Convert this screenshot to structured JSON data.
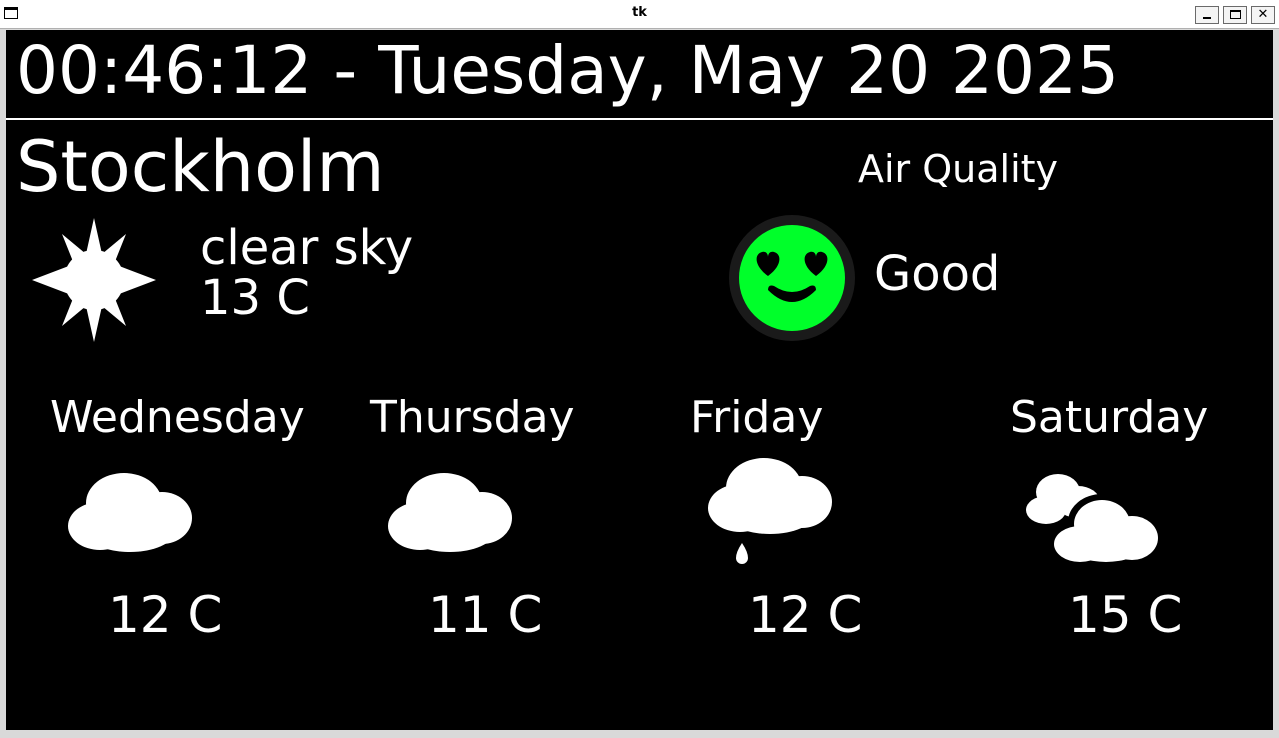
{
  "window": {
    "title": "tk"
  },
  "clock": {
    "text": "00:46:12 - Tuesday, May 20 2025"
  },
  "current": {
    "city": "Stockholm",
    "description": "clear sky",
    "temperature": "13 C",
    "icon": "sun-icon"
  },
  "air_quality": {
    "title": "Air Quality",
    "value": "Good",
    "icon": "smiley-heart-eyes-icon",
    "color": "#00ff2a"
  },
  "forecast": [
    {
      "day": "Wednesday",
      "temperature": "12 C",
      "icon": "cloud-icon"
    },
    {
      "day": "Thursday",
      "temperature": "11 C",
      "icon": "cloud-icon"
    },
    {
      "day": "Friday",
      "temperature": "12 C",
      "icon": "rain-cloud-icon"
    },
    {
      "day": "Saturday",
      "temperature": "15 C",
      "icon": "partly-cloudy-icon"
    }
  ],
  "colors": {
    "background": "#000000",
    "text": "#ffffff",
    "aq_good": "#00ff2a"
  }
}
